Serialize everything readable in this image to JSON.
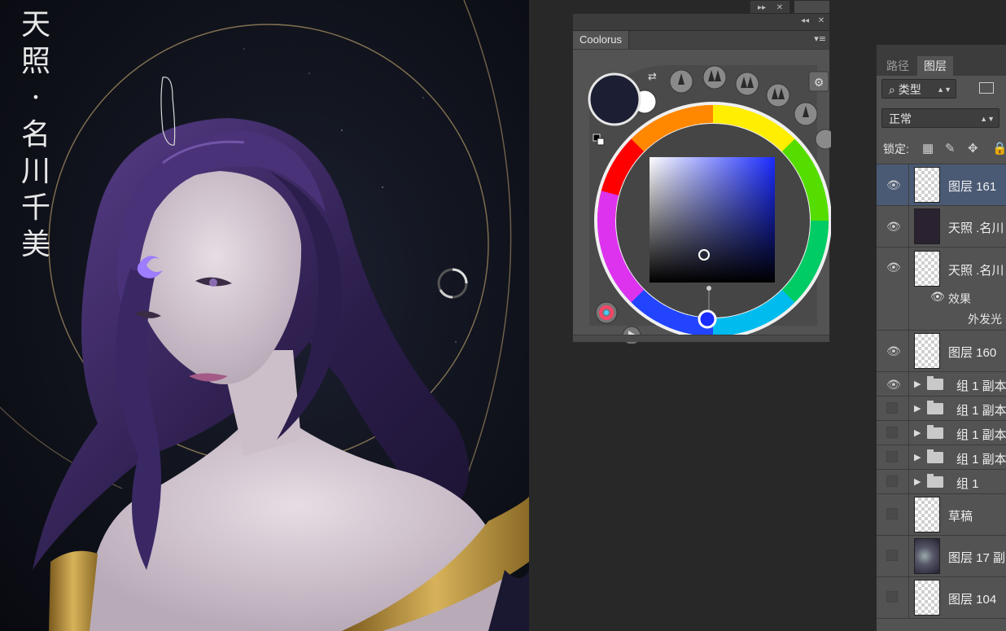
{
  "artwork": {
    "title_text": "天照·名川千美",
    "palette": {
      "hair": "#3c2a63",
      "hair_highlight": "#7b56b8",
      "skin": "#d9cfd6",
      "background": "#10131c",
      "gold": "#c9a24a",
      "ring": "#b39a6a",
      "forehead_mark": "#9f7dff"
    }
  },
  "coolorus": {
    "tab_label": "Coolorus",
    "foreground_color": "#1c1f33",
    "background_color": "#ffffff",
    "icons": [
      "swap-icon",
      "reset-colors-icon",
      "settings-icon",
      "color-wheel-mode-icon",
      "play-icon"
    ]
  },
  "layers_panel": {
    "tabs": [
      {
        "label": "路径",
        "active": false
      },
      {
        "label": "图层",
        "active": true
      }
    ],
    "filter_label": "类型",
    "blend_mode": "正常",
    "lock_label": "锁定:",
    "items": [
      {
        "name": "图层 161",
        "visible": true,
        "selected": true,
        "thumb": "transparent"
      },
      {
        "name": "天照 .名川",
        "visible": true,
        "selected": false,
        "thumb": "dark"
      },
      {
        "name": "天照 .名川",
        "visible": true,
        "selected": false,
        "thumb": "transparent",
        "effects_label": "效果",
        "effect_name": "外发光"
      },
      {
        "name": "图层 160",
        "visible": true,
        "selected": false,
        "thumb": "transparent"
      },
      {
        "name": "组 1 副本",
        "visible": true,
        "group": true
      },
      {
        "name": "组 1 副本",
        "visible": false,
        "group": true
      },
      {
        "name": "组 1 副本",
        "visible": false,
        "group": true
      },
      {
        "name": "组 1 副本",
        "visible": false,
        "group": true
      },
      {
        "name": "组 1",
        "visible": false,
        "group": true
      },
      {
        "name": "草稿",
        "visible": false,
        "thumb": "transparent"
      },
      {
        "name": "图层 17 副",
        "visible": false,
        "thumb": "smoke"
      },
      {
        "name": "图层 104",
        "visible": false,
        "thumb": "transparent"
      }
    ]
  }
}
